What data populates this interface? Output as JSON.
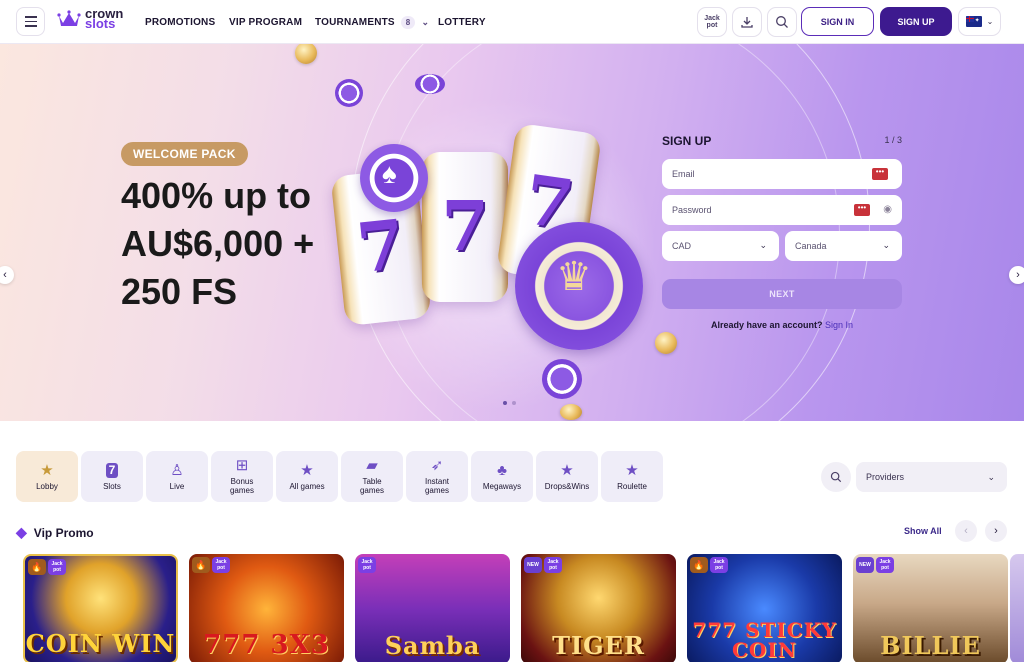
{
  "header": {
    "logo_line1": "crown",
    "logo_line2": "slots",
    "nav": [
      {
        "label": "PROMOTIONS"
      },
      {
        "label": "VIP PROGRAM"
      },
      {
        "label": "TOURNAMENTS",
        "badge": "8"
      },
      {
        "label": "LOTTERY"
      }
    ],
    "jackpot_label": "Jack pot",
    "signin_label": "SIGN IN",
    "signup_label": "SIGN UP",
    "language_flag": "australia-flag-icon"
  },
  "hero": {
    "badge": "WELCOME PACK",
    "title": "400% up to AU$6,000 + 250 FS",
    "colors": {
      "badge": "#c79a64",
      "gradient_start": "#fbe7df",
      "gradient_end": "#a887ea"
    },
    "slide_count": 2,
    "active_slide": 1
  },
  "signup_form": {
    "title": "SIGN UP",
    "step": "1 / 3",
    "email_placeholder": "Email",
    "password_placeholder": "Password",
    "currency": "CAD",
    "country": "Canada",
    "next_label": "NEXT",
    "already_text": "Already have an account?",
    "signin_link": "Sign In"
  },
  "categories": [
    {
      "label": "Lobby",
      "icon": "star-icon",
      "active": true
    },
    {
      "label": "Slots",
      "icon": "seven-icon"
    },
    {
      "label": "Live",
      "icon": "dealer-icon"
    },
    {
      "label": "Bonus games",
      "icon": "gift-icon"
    },
    {
      "label": "All games",
      "icon": "star-icon"
    },
    {
      "label": "Table games",
      "icon": "cards-icon"
    },
    {
      "label": "Instant games",
      "icon": "rocket-icon"
    },
    {
      "label": "Megaways",
      "icon": "clover-icon"
    },
    {
      "label": "Drops&Wins",
      "icon": "star-icon"
    },
    {
      "label": "Roulette",
      "icon": "star-icon"
    }
  ],
  "filters": {
    "providers_label": "Providers"
  },
  "vip_promo": {
    "title": "Vip Promo",
    "show_all": "Show All",
    "games": [
      {
        "name": "COIN WIN",
        "badges": [
          "hot",
          "jackpot"
        ]
      },
      {
        "name": "777 3X3",
        "badges": [
          "hot",
          "jackpot"
        ]
      },
      {
        "name": "Samba",
        "badges": [
          "jackpot"
        ]
      },
      {
        "name": "TIGER",
        "badges": [
          "new",
          "jackpot"
        ]
      },
      {
        "name": "777 STICKY COIN",
        "badges": [
          "hot",
          "jackpot"
        ]
      },
      {
        "name": "BILLIE",
        "badges": [
          "new",
          "jackpot"
        ]
      }
    ],
    "badge_text": {
      "jackpot": "Jack pot",
      "new": "NEW",
      "hot": "🔥"
    }
  }
}
